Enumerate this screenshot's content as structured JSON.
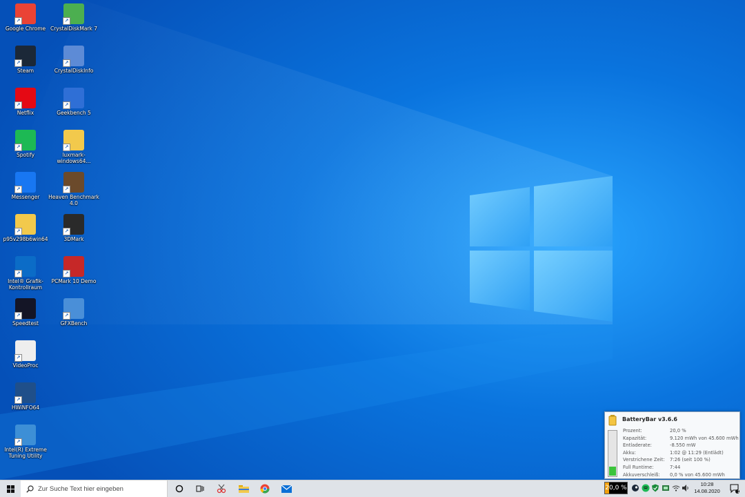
{
  "desktop": {
    "icons": [
      {
        "label": "Google Chrome",
        "icon": "chrome-icon",
        "color": "#ea4335"
      },
      {
        "label": "CrystalDiskMark 7",
        "icon": "crystaldiskmark-icon",
        "color": "#4caf50"
      },
      {
        "label": "Steam",
        "icon": "steam-icon",
        "color": "#1b2838"
      },
      {
        "label": "CrystalDiskInfo",
        "icon": "crystaldiskinfo-icon",
        "color": "#5d8bd6"
      },
      {
        "label": "Netflix",
        "icon": "netflix-icon",
        "color": "#e50914"
      },
      {
        "label": "Geekbench 5",
        "icon": "geekbench-icon",
        "color": "#2f6fd6"
      },
      {
        "label": "Spotify",
        "icon": "spotify-icon",
        "color": "#1db954"
      },
      {
        "label": "luxmark-windows64...",
        "icon": "folder-icon",
        "color": "#f2c94c"
      },
      {
        "label": "Messenger",
        "icon": "messenger-icon",
        "color": "#1877f2"
      },
      {
        "label": "Heaven Benchmark 4.0",
        "icon": "heaven-benchmark-icon",
        "color": "#6b4a2b"
      },
      {
        "label": "p95v298b6win64",
        "icon": "folder-icon",
        "color": "#f2c94c"
      },
      {
        "label": "3DMark",
        "icon": "3dmark-icon",
        "color": "#2a2a2a"
      },
      {
        "label": "Intel® Grafik-Kontrollraum",
        "icon": "intel-graphics-icon",
        "color": "#0b6cc7"
      },
      {
        "label": "PCMark 10 Demo",
        "icon": "pcmark-icon",
        "color": "#c62828"
      },
      {
        "label": "Speedtest",
        "icon": "speedtest-icon",
        "color": "#141526"
      },
      {
        "label": "GFXBench",
        "icon": "gfxbench-icon",
        "color": "#4a8fd8"
      },
      {
        "label": "VideoProc",
        "icon": "videoproc-icon",
        "color": "#eeeeee"
      },
      {
        "label": "HWiNFO64",
        "icon": "hwinfo-icon",
        "color": "#1f4f8a"
      },
      {
        "label": "Intel(R) Extreme Tuning Utility",
        "icon": "intel-xtu-icon",
        "color": "#3d8fd6"
      }
    ]
  },
  "taskbar": {
    "search_placeholder": "Zur Suche Text hier eingeben",
    "battery_percent": "20,0 %",
    "battery_level": 0.2,
    "clock_time": "10:28",
    "clock_date": "14.08.2020",
    "notification_count": "1"
  },
  "battery_popup": {
    "title": "BatteryBar v3.6.6",
    "level": 0.2,
    "rows": [
      {
        "key": "Prozent:",
        "value": "20,0 %"
      },
      {
        "key": "Kapazität:",
        "value": "9.120 mWh von 45.600 mWh"
      },
      {
        "key": "Entladerate:",
        "value": "-8.550 mW"
      },
      {
        "key": "Akku:",
        "value": "1:02 @ 11:29 (Entlädt)"
      },
      {
        "key": "Verstrichene Zeit:",
        "value": "7:26 (seit 100 %)"
      },
      {
        "key": "Full Runtime:",
        "value": "7:44"
      },
      {
        "key": "Akkuverschleiß:",
        "value": "0,0 % von 45.600 mWh"
      }
    ]
  }
}
